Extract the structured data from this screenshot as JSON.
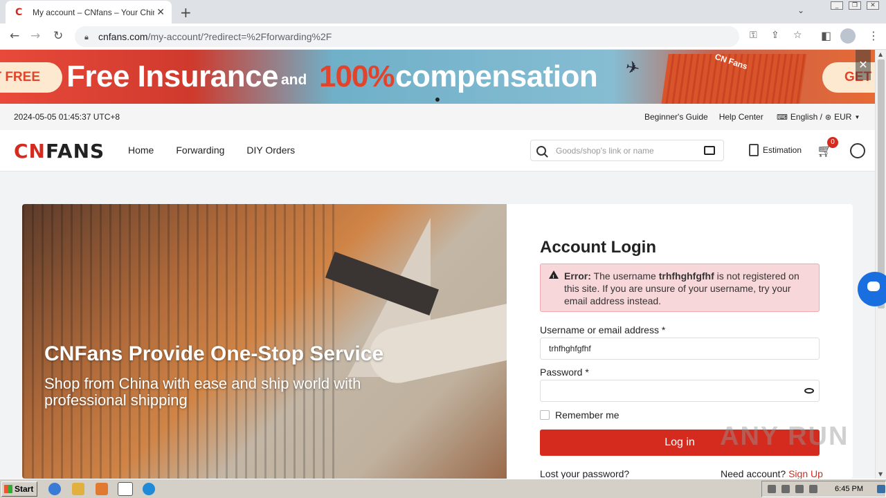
{
  "browser": {
    "tab_title": "My account – CNfans – Your China Sh",
    "url_host": "cnfans.com",
    "url_path": "/my-account/?redirect=%2Fforwarding%2F"
  },
  "banner": {
    "left_pill": "T FREE",
    "headline": "Free Insurance",
    "and": "and",
    "percent": "100%",
    "compensation": "compensation",
    "container_label": "CN Fans",
    "right_pill": "GET I"
  },
  "infobar": {
    "datetime": "2024-05-05 01:45:37 UTC+8",
    "beginners_guide": "Beginner's Guide",
    "help_center": "Help Center",
    "language": "English /",
    "currency": "EUR"
  },
  "header": {
    "logo_red": "CN",
    "logo_dark": "FANS",
    "nav": [
      "Home",
      "Forwarding",
      "DIY Orders"
    ],
    "search_placeholder": "Goods/shop's link or name",
    "estimation": "Estimation",
    "cart_count": "0"
  },
  "hero": {
    "title": "CNFans Provide One-Stop Service",
    "subtitle": "Shop from China with ease and ship world with professional shipping"
  },
  "login": {
    "heading": "Account Login",
    "error_label": "Error:",
    "error_pre": " The username ",
    "error_user": "trhfhghfgfhf",
    "error_post": " is not registered on this site. If you are unsure of your username, try your email address instead.",
    "username_label": "Username or email address  *",
    "username_value": "trhfhghfgfhf",
    "password_label": "Password *",
    "password_value": "",
    "remember": "Remember me",
    "login_button": "Log in",
    "lost_password": "Lost your password?",
    "need_account": "Need account? ",
    "sign_up": "Sign Up"
  },
  "watermark": "ANY RUN",
  "taskbar": {
    "start": "Start",
    "clock": "6:45 PM"
  }
}
